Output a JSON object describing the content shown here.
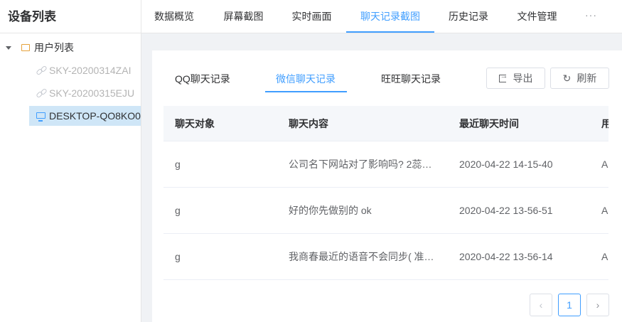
{
  "sidebar": {
    "title": "设备列表",
    "root_label": "用户列表",
    "devices": [
      {
        "name": "SKY-20200314ZAI",
        "status": "offline"
      },
      {
        "name": "SKY-20200315EJU",
        "status": "offline"
      },
      {
        "name": "DESKTOP-QO8KO0",
        "status": "online"
      }
    ]
  },
  "topnav": {
    "tabs": [
      "数据概览",
      "屏幕截图",
      "实时画面",
      "聊天记录截图",
      "历史记录",
      "文件管理"
    ],
    "active_index": 3,
    "more": "···"
  },
  "subtabs": {
    "tabs": [
      "QQ聊天记录",
      "微信聊天记录",
      "旺旺聊天记录"
    ],
    "active_index": 1
  },
  "toolbar": {
    "export_label": "导出",
    "refresh_label": "刷新",
    "refresh_icon": "↻"
  },
  "table": {
    "columns": [
      "聊天对象",
      "聊天内容",
      "最近聊天时间",
      "用"
    ],
    "rows": [
      {
        "target": "g",
        "content": "公司名下网站对了影响吗? 2蕊…",
        "time": "2020-04-22 14-15-40",
        "extra": "A("
      },
      {
        "target": "g",
        "content": "好的你先做别的 ok",
        "time": "2020-04-22 13-56-51",
        "extra": "A("
      },
      {
        "target": "g",
        "content": "我商春最近的语音不会同步( 准…",
        "time": "2020-04-22 13-56-14",
        "extra": "A("
      }
    ]
  },
  "pagination": {
    "prev": "‹",
    "current": "1",
    "next": "›"
  },
  "colors": {
    "accent": "#409eff",
    "offline_text": "#b4b4b4",
    "selected_bg": "#cfe6f7",
    "folder": "#e6a23c"
  }
}
